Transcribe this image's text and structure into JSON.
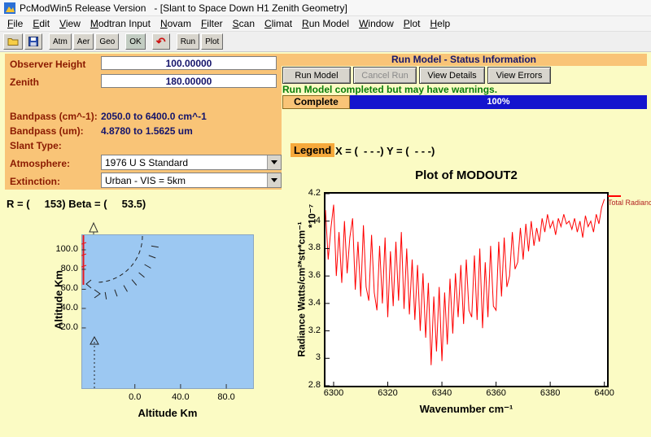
{
  "window": {
    "title": "PcModWin5 Release Version   - [Slant to Space Down H1 Zenith Geometry]"
  },
  "menu": {
    "items": [
      "File",
      "Edit",
      "View",
      "Modtran Input",
      "Novam",
      "Filter",
      "Scan",
      "Climat",
      "Run Model",
      "Window",
      "Plot",
      "Help"
    ]
  },
  "toolbar": {
    "open_icon": "folder-open-icon",
    "save_icon": "save-icon",
    "undo_icon": "undo-icon",
    "atm": "Atm",
    "aer": "Aer",
    "geo": "Geo",
    "ok": "OK",
    "run": "Run",
    "plot": "Plot"
  },
  "params": {
    "observer_height_label": "Observer Height",
    "observer_height_value": "100.00000",
    "zenith_label": "Zenith",
    "zenith_value": "180.00000",
    "bandpass_cm_label": "Bandpass (cm^-1):",
    "bandpass_cm_value": "2050.0 to 6400.0 cm^-1",
    "bandpass_um_label": "Bandpass (um):",
    "bandpass_um_value": "4.8780 to 1.5625 um",
    "slant_type_label": "Slant Type:",
    "atmosphere_label": "Atmosphere:",
    "atmosphere_value": "1976 U S Standard",
    "extinction_label": "Extinction:",
    "extinction_value": "Urban - VIS = 5km"
  },
  "status": {
    "header": "Run Model - Status Information",
    "run": "Run Model",
    "cancel": "Cancel Run",
    "details": "View Details",
    "errors": "View Errors",
    "message": "Run Model completed but may have warnings.",
    "complete_label": "Complete",
    "progress": "100%",
    "progress_color": "#1414CE",
    "accent_orange": "#F9C477"
  },
  "legend_line": {
    "legend": "Legend",
    "text": "X = (  - - -) Y = (  - - -)"
  },
  "geometry": {
    "r_beta": "R = (     153) Beta = (     53.5)",
    "x_axis_label": "Altitude Km",
    "y_axis_label": "Altitude Km",
    "x_ticks": [
      "0.0",
      "40.0",
      "80.0"
    ],
    "y_ticks": [
      "100.0",
      "80.0",
      "60.0",
      "40.0",
      "20.0"
    ],
    "fill_color": "#9CC8F2"
  },
  "chart_data": {
    "type": "line",
    "title": "Plot of MODOUT2",
    "xlabel": "Wavenumber cm⁻¹",
    "ylabel": "Radiance Watts/cm²*str*cm⁻¹",
    "ylabel_scale": "*10⁻⁷",
    "legend": "Total Radiance",
    "legend_position": "top-right-outside",
    "grid": false,
    "xlim": [
      6297,
      6401
    ],
    "ylim": [
      2.8,
      4.2
    ],
    "x_ticks": [
      6300,
      6320,
      6340,
      6360,
      6380,
      6400
    ],
    "y_ticks": [
      2.8,
      3,
      3.2,
      3.4,
      3.6,
      3.8,
      4,
      4.2
    ],
    "series": [
      {
        "name": "Total Radiance",
        "color": "#ff0000",
        "x": [
          6297,
          6298,
          6299,
          6300,
          6301,
          6302,
          6303,
          6304,
          6305,
          6306,
          6307,
          6308,
          6309,
          6310,
          6311,
          6312,
          6313,
          6314,
          6315,
          6316,
          6317,
          6318,
          6319,
          6320,
          6321,
          6322,
          6323,
          6324,
          6325,
          6326,
          6327,
          6328,
          6329,
          6330,
          6331,
          6332,
          6333,
          6334,
          6335,
          6336,
          6337,
          6338,
          6339,
          6340,
          6341,
          6342,
          6343,
          6344,
          6345,
          6346,
          6347,
          6348,
          6349,
          6350,
          6351,
          6352,
          6353,
          6354,
          6355,
          6356,
          6357,
          6358,
          6359,
          6360,
          6361,
          6362,
          6363,
          6364,
          6365,
          6366,
          6367,
          6368,
          6369,
          6370,
          6371,
          6372,
          6373,
          6374,
          6375,
          6376,
          6377,
          6378,
          6379,
          6380,
          6381,
          6382,
          6383,
          6384,
          6385,
          6386,
          6387,
          6388,
          6389,
          6390,
          6391,
          6392,
          6393,
          6394,
          6395,
          6396,
          6397,
          6398,
          6399,
          6400
        ],
        "y": [
          4.08,
          3.72,
          3.95,
          4.12,
          3.6,
          3.92,
          3.55,
          4.0,
          3.62,
          3.88,
          4.02,
          3.5,
          3.85,
          3.45,
          3.97,
          3.52,
          3.42,
          3.9,
          3.48,
          3.35,
          3.82,
          3.4,
          3.88,
          3.3,
          3.78,
          3.38,
          3.85,
          3.42,
          3.92,
          3.36,
          3.8,
          3.32,
          3.72,
          3.28,
          3.68,
          3.2,
          3.62,
          3.15,
          3.55,
          2.95,
          3.45,
          3.05,
          3.52,
          2.98,
          3.48,
          3.1,
          3.58,
          3.18,
          3.62,
          3.3,
          3.68,
          3.25,
          3.72,
          3.35,
          3.3,
          3.75,
          3.28,
          3.8,
          3.22,
          3.7,
          3.3,
          3.82,
          3.38,
          3.35,
          3.85,
          3.45,
          3.88,
          3.52,
          3.6,
          3.92,
          3.65,
          3.7,
          3.95,
          3.72,
          3.98,
          3.78,
          4.0,
          3.82,
          3.95,
          3.85,
          4.02,
          3.92,
          4.05,
          3.95,
          4.0,
          3.9,
          4.02,
          3.96,
          4.05,
          3.98,
          4.0,
          3.94,
          4.02,
          3.92,
          4.0,
          3.88,
          4.04,
          3.96,
          4.0,
          3.92,
          4.05,
          3.98,
          4.1,
          4.16
        ]
      }
    ]
  }
}
